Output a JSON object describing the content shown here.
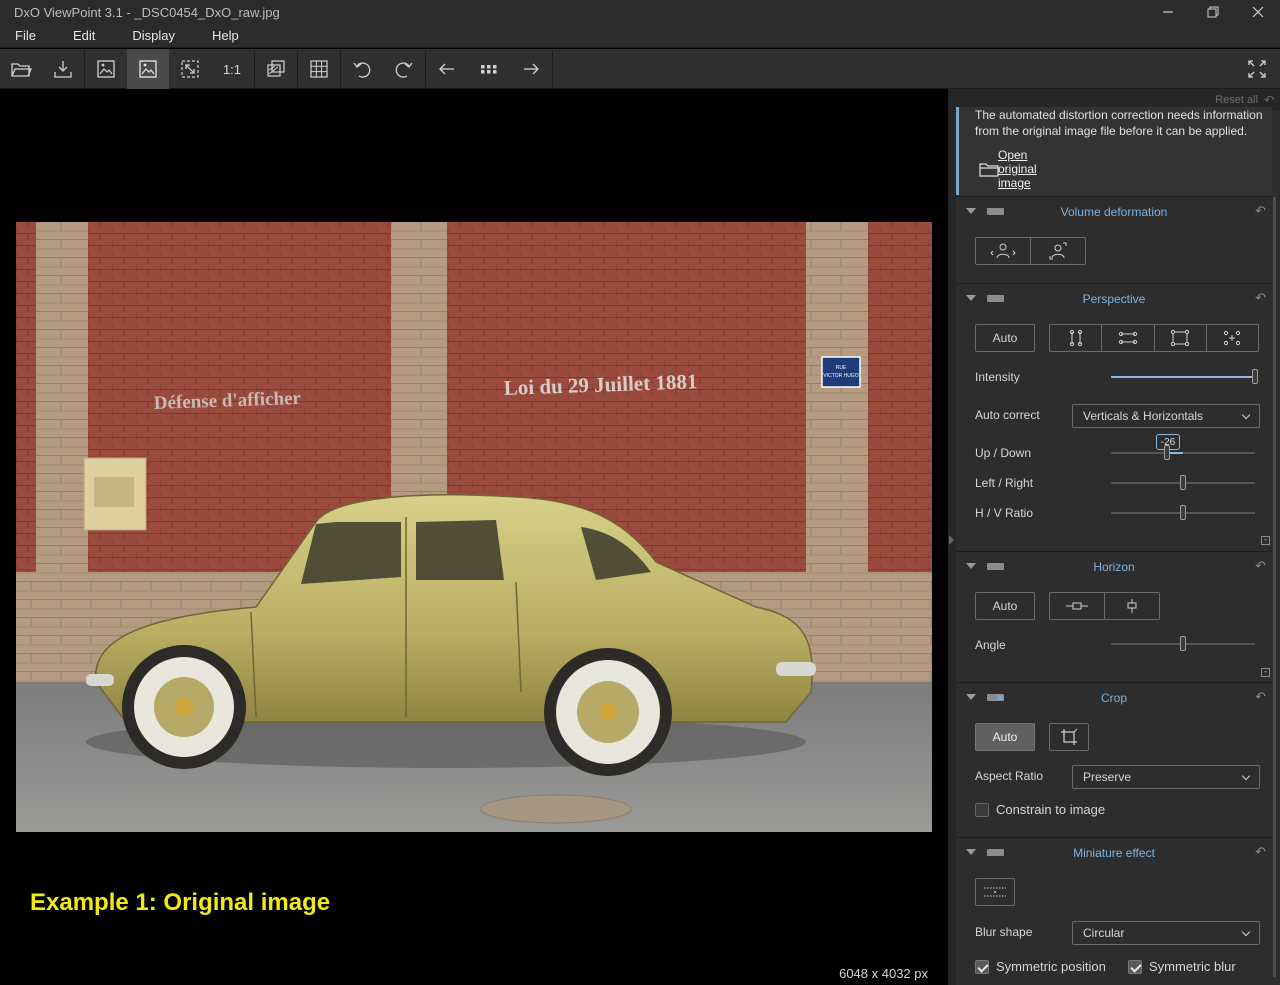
{
  "window": {
    "title": "DxO ViewPoint 3.1 - _DSC0454_DxO_raw.jpg"
  },
  "menu": [
    "File",
    "Edit",
    "Display",
    "Help"
  ],
  "toolbar": {
    "one_to_one": "1:1"
  },
  "canvas": {
    "caption": "Example 1: Original image",
    "dimensions": "6048 x 4032 px"
  },
  "photo_text": {
    "left_sign": "Défense d'afficher",
    "right_sign": "Loi du 29 Juillet 1881",
    "street_plate": "RUE VICTOR HUGO"
  },
  "panel": {
    "reset_all": "Reset all",
    "notice": {
      "text": "The automated distortion correction needs information from the original image file before it can be applied.",
      "link": "Open original image"
    },
    "volume": {
      "title": "Volume deformation"
    },
    "perspective": {
      "title": "Perspective",
      "auto": "Auto",
      "intensity_label": "Intensity",
      "intensity_value": 1.0,
      "auto_correct_label": "Auto correct",
      "auto_correct_value": "Verticals & Horizontals",
      "up_down_label": "Up / Down",
      "up_down_value": "-26",
      "up_down_fraction": 0.39,
      "left_right_label": "Left / Right",
      "left_right_fraction": 0.5,
      "hv_ratio_label": "H / V Ratio",
      "hv_ratio_fraction": 0.5
    },
    "horizon": {
      "title": "Horizon",
      "auto": "Auto",
      "angle_label": "Angle",
      "angle_fraction": 0.5
    },
    "crop": {
      "title": "Crop",
      "auto": "Auto",
      "aspect_label": "Aspect Ratio",
      "aspect_value": "Preserve",
      "constrain": "Constrain to image",
      "constrain_checked": false
    },
    "miniature": {
      "title": "Miniature effect",
      "blur_shape_label": "Blur shape",
      "blur_shape_value": "Circular",
      "symmetric_position": "Symmetric position",
      "symmetric_blur": "Symmetric blur"
    }
  },
  "colors": {
    "accent": "#7eb3e0",
    "caption": "#f2ea12"
  }
}
